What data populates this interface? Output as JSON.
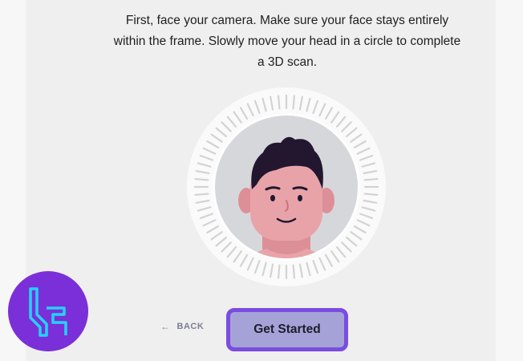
{
  "instructions": {
    "line1": "First, face your camera. Make sure your face stays entirely",
    "line2": "within the frame. Slowly move your head in a circle to complete",
    "line3": "a 3D scan."
  },
  "scan": {
    "icon": "face-avatar",
    "ring_color": "#d3d3d3",
    "skin_color": "#e8a3a9",
    "hair_color": "#22172f"
  },
  "actions": {
    "back_label": "BACK",
    "back_icon": "arrow-left",
    "primary_label": "Get Started",
    "primary_border": "#7b4ce0",
    "primary_fill": "#a5a2d8"
  },
  "brand": {
    "icon": "logo-badge",
    "badge_color": "#7b2fd8",
    "glyph_color": "#22d3ff"
  }
}
